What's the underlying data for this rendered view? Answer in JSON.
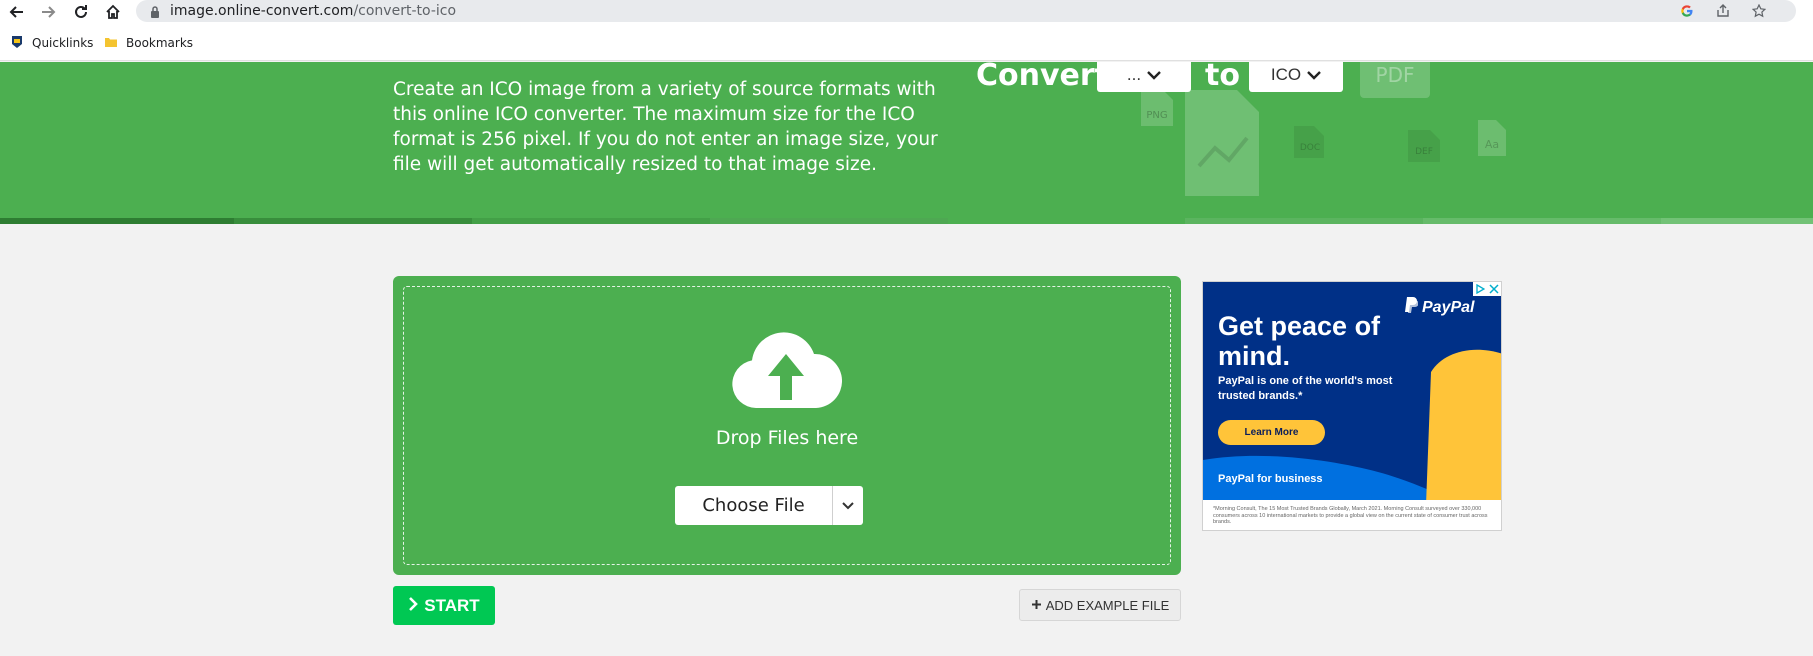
{
  "browser": {
    "url_host": "image.online-convert.com",
    "url_path": "/convert-to-ico",
    "bookmarks": [
      {
        "label": "Quicklinks",
        "icon": "quicklinks-icon"
      },
      {
        "label": "Bookmarks",
        "icon": "folder-icon"
      }
    ]
  },
  "hero": {
    "description": "Create an ICO image from a variety of source formats with this online ICO converter. The maximum size for the ICO format is 256 pixel. If you do not enter an image size, your file will get automatically resized to that image size.",
    "convert_label": "Convert",
    "from_value": "...",
    "to_label": "to",
    "to_value": "ICO",
    "bg_icons": [
      "PNG",
      "PDF",
      "DOC",
      "DEF",
      "Aa"
    ],
    "color": "#4caf50"
  },
  "upload": {
    "drop_text": "Drop Files here",
    "choose_label": "Choose File"
  },
  "actions": {
    "start_label": "START",
    "example_label": "ADD EXAMPLE FILE"
  },
  "ad": {
    "brand": "PayPal",
    "headline": "Get peace of mind.",
    "subtext": "PayPal is one of the world's most trusted brands.*",
    "cta": "Learn More",
    "business": "PayPal for business",
    "footnote": "*Morning Consult, The 15 Most Trusted Brands Globally, March 2021. Morning Consult surveyed over 330,000 consumers across 10 international markets to provide a global view on the current state of consumer trust across brands.",
    "colors": {
      "navy": "#003087",
      "blue": "#0070e0",
      "yellow": "#ffc439"
    }
  }
}
